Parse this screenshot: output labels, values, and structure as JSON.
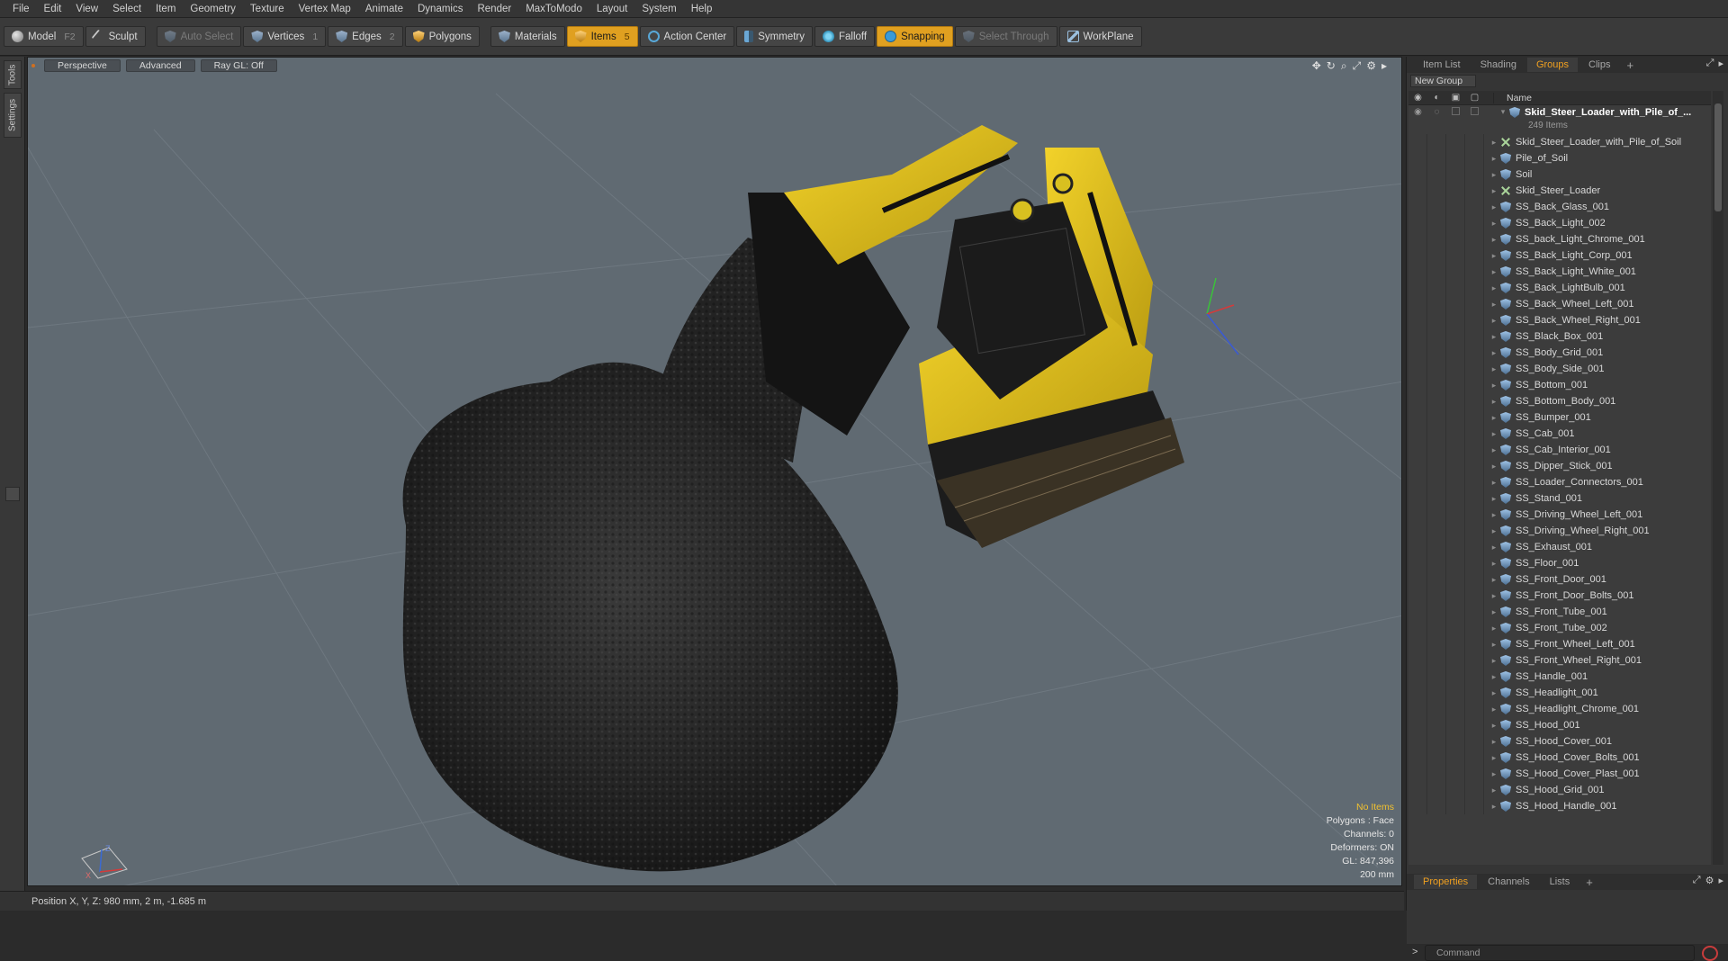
{
  "menu": [
    "File",
    "Edit",
    "View",
    "Select",
    "Item",
    "Geometry",
    "Texture",
    "Vertex Map",
    "Animate",
    "Dynamics",
    "Render",
    "MaxToModo",
    "Layout",
    "System",
    "Help"
  ],
  "toolbar": {
    "model": "Model",
    "model_key": "F2",
    "sculpt": "Sculpt",
    "auto_select": "Auto Select",
    "vertices": "Vertices",
    "vertices_key": "1",
    "edges": "Edges",
    "edges_key": "2",
    "polygons": "Polygons",
    "materials": "Materials",
    "items": "Items",
    "items_key": "5",
    "action_center": "Action Center",
    "symmetry": "Symmetry",
    "falloff": "Falloff",
    "snapping": "Snapping",
    "select_through": "Select Through",
    "workplane": "WorkPlane",
    "accent": "#e0a020"
  },
  "left_tabs": [
    "Tools",
    "Settings"
  ],
  "viewport": {
    "view": "Perspective",
    "mode": "Advanced",
    "raygl": "Ray GL: Off",
    "info": {
      "selection": "No Items",
      "polygons": "Polygons : Face",
      "channels": "Channels: 0",
      "deformers": "Deformers: ON",
      "gl": "GL: 847,396",
      "scale": "200 mm"
    },
    "axis_labels": {
      "x": "X",
      "z": "Z"
    }
  },
  "status": {
    "position": "Position X, Y, Z:   980 mm, 2 m, -1.685 m"
  },
  "right_panel": {
    "tabs": [
      "Item List",
      "Shading",
      "Groups",
      "Clips"
    ],
    "active_tab": "Groups",
    "new_group": "New Group",
    "name_header": "Name",
    "root": {
      "label": "Skid_Steer_Loader_with_Pile_of_...",
      "count": "249 Items"
    },
    "items": [
      {
        "label": "Skid_Steer_Loader_with_Pile_of_Soil",
        "icon": "locator-icon"
      },
      {
        "label": "Pile_of_Soil",
        "icon": "mesh-icon"
      },
      {
        "label": "Soil",
        "icon": "mesh-icon"
      },
      {
        "label": "Skid_Steer_Loader",
        "icon": "locator-icon"
      },
      {
        "label": "SS_Back_Glass_001",
        "icon": "mesh-icon"
      },
      {
        "label": "SS_Back_Light_002",
        "icon": "mesh-icon"
      },
      {
        "label": "SS_back_Light_Chrome_001",
        "icon": "mesh-icon"
      },
      {
        "label": "SS_Back_Light_Corp_001",
        "icon": "mesh-icon"
      },
      {
        "label": "SS_Back_Light_White_001",
        "icon": "mesh-icon"
      },
      {
        "label": "SS_Back_LightBulb_001",
        "icon": "mesh-icon"
      },
      {
        "label": "SS_Back_Wheel_Left_001",
        "icon": "mesh-icon"
      },
      {
        "label": "SS_Back_Wheel_Right_001",
        "icon": "mesh-icon"
      },
      {
        "label": "SS_Black_Box_001",
        "icon": "mesh-icon"
      },
      {
        "label": "SS_Body_Grid_001",
        "icon": "mesh-icon"
      },
      {
        "label": "SS_Body_Side_001",
        "icon": "mesh-icon"
      },
      {
        "label": "SS_Bottom_001",
        "icon": "mesh-icon"
      },
      {
        "label": "SS_Bottom_Body_001",
        "icon": "mesh-icon"
      },
      {
        "label": "SS_Bumper_001",
        "icon": "mesh-icon"
      },
      {
        "label": "SS_Cab_001",
        "icon": "mesh-icon"
      },
      {
        "label": "SS_Cab_Interior_001",
        "icon": "mesh-icon"
      },
      {
        "label": "SS_Dipper_Stick_001",
        "icon": "mesh-icon"
      },
      {
        "label": "SS_Loader_Connectors_001",
        "icon": "mesh-icon"
      },
      {
        "label": "SS_Stand_001",
        "icon": "mesh-icon"
      },
      {
        "label": "SS_Driving_Wheel_Left_001",
        "icon": "mesh-icon"
      },
      {
        "label": "SS_Driving_Wheel_Right_001",
        "icon": "mesh-icon"
      },
      {
        "label": "SS_Exhaust_001",
        "icon": "mesh-icon"
      },
      {
        "label": "SS_Floor_001",
        "icon": "mesh-icon"
      },
      {
        "label": "SS_Front_Door_001",
        "icon": "mesh-icon"
      },
      {
        "label": "SS_Front_Door_Bolts_001",
        "icon": "mesh-icon"
      },
      {
        "label": "SS_Front_Tube_001",
        "icon": "mesh-icon"
      },
      {
        "label": "SS_Front_Tube_002",
        "icon": "mesh-icon"
      },
      {
        "label": "SS_Front_Wheel_Left_001",
        "icon": "mesh-icon"
      },
      {
        "label": "SS_Front_Wheel_Right_001",
        "icon": "mesh-icon"
      },
      {
        "label": "SS_Handle_001",
        "icon": "mesh-icon"
      },
      {
        "label": "SS_Headlight_001",
        "icon": "mesh-icon"
      },
      {
        "label": "SS_Headlight_Chrome_001",
        "icon": "mesh-icon"
      },
      {
        "label": "SS_Hood_001",
        "icon": "mesh-icon"
      },
      {
        "label": "SS_Hood_Cover_001",
        "icon": "mesh-icon"
      },
      {
        "label": "SS_Hood_Cover_Bolts_001",
        "icon": "mesh-icon"
      },
      {
        "label": "SS_Hood_Cover_Plast_001",
        "icon": "mesh-icon"
      },
      {
        "label": "SS_Hood_Grid_001",
        "icon": "mesh-icon"
      },
      {
        "label": "SS_Hood_Handle_001",
        "icon": "mesh-icon"
      }
    ],
    "bottom_tabs": [
      "Properties",
      "Channels",
      "Lists"
    ],
    "command_placeholder": "Command"
  }
}
